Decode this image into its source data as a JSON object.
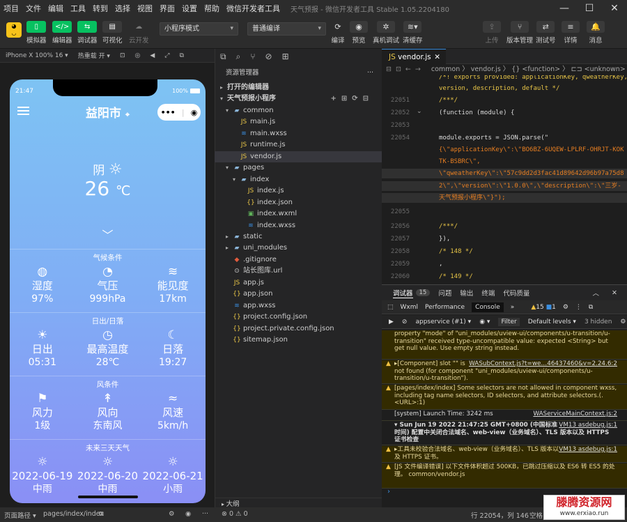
{
  "menubar": {
    "items": [
      "项目",
      "文件",
      "编辑",
      "工具",
      "转到",
      "选择",
      "视图",
      "界面",
      "设置",
      "帮助",
      "微信开发者工具"
    ],
    "window_title": "天气预报 - 微信开发者工具 Stable 1.05.2204180",
    "window_buttons": [
      "—",
      "☐",
      "✕"
    ]
  },
  "toolbar": {
    "left_buttons": [
      {
        "label": "模拟器",
        "icon": "phone-icon",
        "color": "#07c160"
      },
      {
        "label": "编辑器",
        "icon": "code-icon",
        "color": "#07c160"
      },
      {
        "label": "调试器",
        "icon": "debug-icon",
        "color": "#07c160"
      },
      {
        "label": "可视化",
        "icon": "visual-icon",
        "color": "#3a3a3a"
      },
      {
        "label": "云开发",
        "icon": "cloud-icon",
        "color": "#3a3a3a"
      }
    ],
    "mode_select": "小程序模式",
    "compile_select": "普通编译",
    "mid_buttons": [
      {
        "label": "编译",
        "icon": "refresh-icon"
      },
      {
        "label": "预览",
        "icon": "eye-icon"
      },
      {
        "label": "真机调试",
        "icon": "bug-icon"
      },
      {
        "label": "清缓存",
        "icon": "layers-icon"
      }
    ],
    "right_buttons": [
      {
        "label": "上传",
        "icon": "upload-icon"
      },
      {
        "label": "版本管理",
        "icon": "branch-icon"
      },
      {
        "label": "测试号",
        "icon": "test-icon"
      },
      {
        "label": "详情",
        "icon": "menu-icon"
      },
      {
        "label": "消息",
        "icon": "bell-icon"
      }
    ]
  },
  "simulator": {
    "device": "iPhone X 100% 16 ▾",
    "hot_reload": "热重载 开 ▾"
  },
  "phone": {
    "time": "21:47",
    "battery": "100%",
    "city": "益阳市",
    "condition": "阴",
    "temperature": "26",
    "temp_unit": "℃",
    "sections": [
      {
        "title": "气候条件",
        "cells": [
          {
            "icon": "💧",
            "name": "湿度",
            "value": "97%"
          },
          {
            "icon": "◔",
            "name": "气压",
            "value": "999hPa"
          },
          {
            "icon": "≋",
            "name": "能见度",
            "value": "17km"
          }
        ]
      },
      {
        "title": "日出/日落",
        "cells": [
          {
            "icon": "☀",
            "name": "日出",
            "value": "05:31"
          },
          {
            "icon": "◷",
            "name": "最高温度",
            "value": "28℃"
          },
          {
            "icon": "☾",
            "name": "日落",
            "value": "19:27"
          }
        ]
      },
      {
        "title": "风条件",
        "cells": [
          {
            "icon": "⚑",
            "name": "风力",
            "value": "1级"
          },
          {
            "icon": "↟",
            "name": "风向",
            "value": "东南风"
          },
          {
            "icon": "≈",
            "name": "风速",
            "value": "5km/h"
          }
        ]
      },
      {
        "title": "未来三天天气",
        "cells": [
          {
            "icon": "☼",
            "name": "2022-06-19",
            "value": "中雨"
          },
          {
            "icon": "☼",
            "name": "2022-06-20",
            "value": "中雨"
          },
          {
            "icon": "☼",
            "name": "2022-06-21",
            "value": "小雨"
          }
        ]
      }
    ]
  },
  "explorer": {
    "title": "资源管理器",
    "open_editors": "打开的编辑器",
    "project": "天气预报小程序",
    "tree": [
      {
        "depth": 1,
        "arrow": "▾",
        "type": "folder",
        "name": "common"
      },
      {
        "depth": 2,
        "arrow": "",
        "type": "js",
        "name": "main.js"
      },
      {
        "depth": 2,
        "arrow": "",
        "type": "css",
        "name": "main.wxss"
      },
      {
        "depth": 2,
        "arrow": "",
        "type": "js",
        "name": "runtime.js"
      },
      {
        "depth": 2,
        "arrow": "",
        "type": "js",
        "name": "vendor.js"
      },
      {
        "depth": 1,
        "arrow": "▾",
        "type": "folder",
        "name": "pages"
      },
      {
        "depth": 2,
        "arrow": "▾",
        "type": "folder",
        "name": "index"
      },
      {
        "depth": 3,
        "arrow": "",
        "type": "js",
        "name": "index.js"
      },
      {
        "depth": 3,
        "arrow": "",
        "type": "json",
        "name": "index.json"
      },
      {
        "depth": 3,
        "arrow": "",
        "type": "wxml",
        "name": "index.wxml"
      },
      {
        "depth": 3,
        "arrow": "",
        "type": "css",
        "name": "index.wxss"
      },
      {
        "depth": 1,
        "arrow": "▸",
        "type": "folder",
        "name": "static"
      },
      {
        "depth": 1,
        "arrow": "▸",
        "type": "folder",
        "name": "uni_modules"
      },
      {
        "depth": 1,
        "arrow": "",
        "type": "git",
        "name": ".gitignore"
      },
      {
        "depth": 1,
        "arrow": "",
        "type": "url",
        "name": "站长图库.url"
      },
      {
        "depth": 1,
        "arrow": "",
        "type": "js",
        "name": "app.js"
      },
      {
        "depth": 1,
        "arrow": "",
        "type": "json",
        "name": "app.json"
      },
      {
        "depth": 1,
        "arrow": "",
        "type": "css",
        "name": "app.wxss"
      },
      {
        "depth": 1,
        "arrow": "",
        "type": "json",
        "name": "project.config.json"
      },
      {
        "depth": 1,
        "arrow": "",
        "type": "json",
        "name": "project.private.config.json"
      },
      {
        "depth": 1,
        "arrow": "",
        "type": "json",
        "name": "sitemap.json"
      }
    ],
    "outline": "大纲"
  },
  "editor": {
    "tab": "vendor.js",
    "breadcrumb": "common  〉 vendor.js 〉 {} <function> 〉 ⊏⊐ <unknown>",
    "lines": [
      {
        "n": "",
        "cls": "cm",
        "t": "/*! exports provided: applicationKey, qweatherKey,"
      },
      {
        "n": "",
        "cls": "cm",
        "t": "version, description, default */"
      },
      {
        "n": "22051",
        "cls": "cm",
        "t": "/***/"
      },
      {
        "n": "22052",
        "cls": "pl",
        "t": "(function (module) {"
      },
      {
        "n": "22053",
        "cls": "pl",
        "t": ""
      },
      {
        "n": "22054",
        "cls": "pl",
        "t": "  module.exports = JSON.parse(\""
      },
      {
        "n": "",
        "cls": "str",
        "t": "  {\\\"applicationKey\\\":\\\"BO6BZ-6UQEW-LPLRF-OHRJT-KOK"
      },
      {
        "n": "",
        "cls": "str",
        "t": "  TK-BSBRC\\\","
      },
      {
        "n": "",
        "cls": "str",
        "t": "  \\\"qweatherKey\\\":\\\"57c9dd2d3fac41d89642d96b97a75d8"
      },
      {
        "n": "",
        "cls": "str",
        "t": "  2\\\",\\\"version\\\":\\\"1.0.0\\\",\\\"description\\\":\\\"三岁-"
      },
      {
        "n": "",
        "cls": "str",
        "t": "  天气预报小程序\\\"}\");"
      },
      {
        "n": "22055",
        "cls": "pl",
        "t": ""
      },
      {
        "n": "22056",
        "cls": "cm",
        "t": "  /***/"
      },
      {
        "n": "22057",
        "cls": "pl",
        "t": "}),"
      },
      {
        "n": "22058",
        "cls": "cm",
        "t": "/* 148 */"
      },
      {
        "n": "22059",
        "cls": "pl",
        "t": ","
      },
      {
        "n": "22060",
        "cls": "cm",
        "t": "/* 149 */"
      }
    ]
  },
  "devtools": {
    "tabs": [
      "调试器",
      "15",
      "问题",
      "输出",
      "终端",
      "代码质量"
    ],
    "panels": [
      "Wxml",
      "Performance",
      "Console",
      "»"
    ],
    "warn_count": "15",
    "err_count": "1",
    "context": "appservice (#1)",
    "filter": "Filter",
    "levels": "Default levels ▾",
    "hidden": "3 hidden",
    "messages": [
      {
        "kind": "warn",
        "text": "property \"mode\" of \"uni_modules/uview-ui/components/u-transition/u-transition\" received type-uncompatible value: expected <String> but get null value. Use empty string instead."
      },
      {
        "kind": "warn",
        "text": "▸[Component] slot \"\" is not found (for component \"uni_modules/uview-ui/components/u-transition/u-transition\").",
        "link": "WASubContext.js?t=we…46437460&v=2.24.6:2"
      },
      {
        "kind": "warn",
        "text": "[pages/index/index] Some selectors are not allowed in component wxss, including tag name selectors, ID selectors, and attribute selectors.(.<URL>:1)"
      },
      {
        "kind": "plain",
        "text": "[system] Launch Time: 3242 ms",
        "link": "WAServiceMainContext.js:2"
      },
      {
        "kind": "plain",
        "text": "▾ Sun Jun 19 2022 21:47:25 GMT+0800 (中国标准时间) 配置中关闭合法域名、web-view（业务域名）、TLS 版本以及 HTTPS 证书检查",
        "link": "VM13 asdebug.js:1"
      },
      {
        "kind": "warn",
        "text": "▸工具未校验合法域名、web-view（业务域名）、TLS 版本以及 HTTPS 证书。",
        "link": "VM13 asdebug.js:1"
      },
      {
        "kind": "warn",
        "text": "[JS 文件编译错误] 以下文件体积超过 500KB，已跳过压缩以及 ES6 转 ES5 的处理。 common/vendor.js"
      }
    ]
  },
  "statusbar": {
    "path_label": "页面路径 ▾",
    "path": "pages/index/index",
    "errors": "⊗ 0 ⚠ 0",
    "cursor": "行 22054，列 146",
    "encoding": "空格"
  },
  "watermark": {
    "title": "滕腾资源网",
    "url": "www.erxiao.run"
  }
}
